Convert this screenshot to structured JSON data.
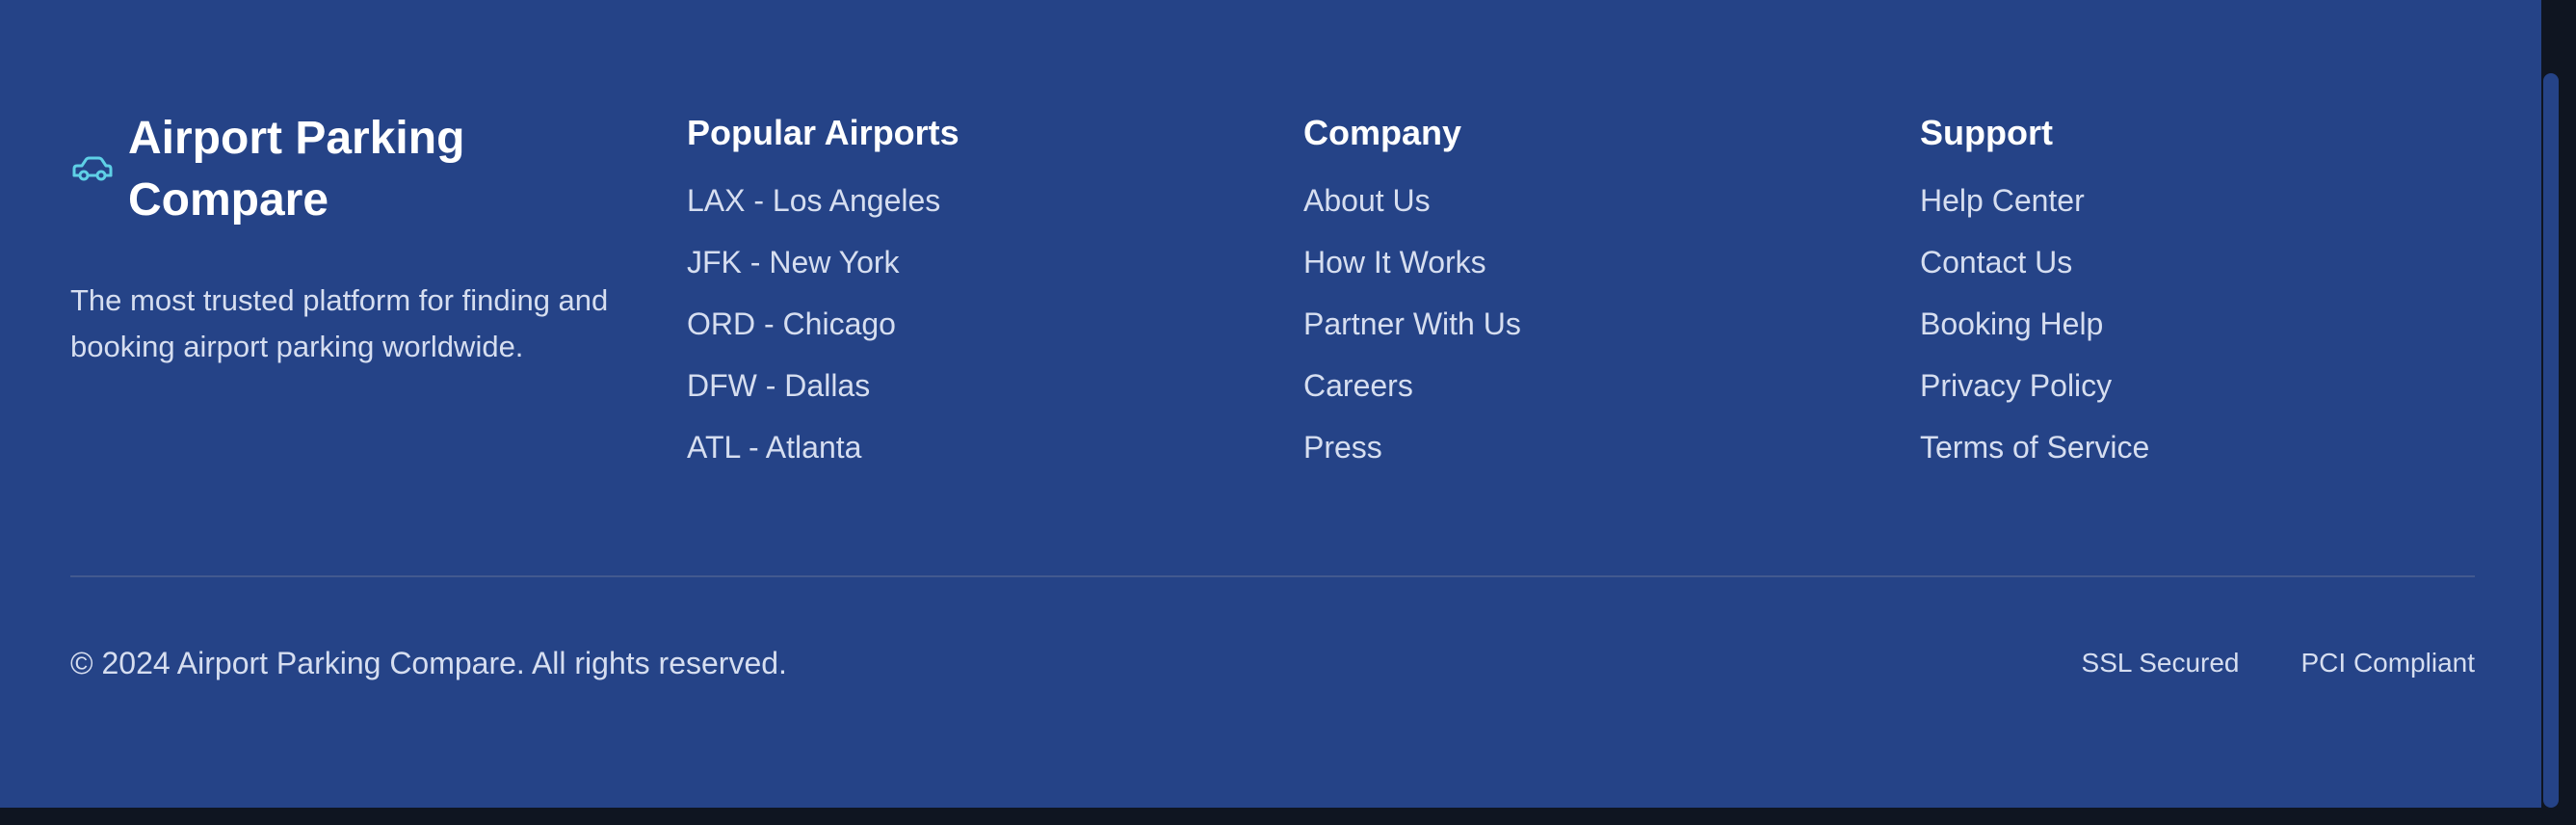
{
  "brand": {
    "title": "Airport Parking Compare",
    "icon": "car-icon",
    "description": "The most trusted platform for finding and booking airport parking worldwide."
  },
  "columns": [
    {
      "heading": "Popular Airports",
      "links": [
        "LAX - Los Angeles",
        "JFK - New York",
        "ORD - Chicago",
        "DFW - Dallas",
        "ATL - Atlanta"
      ]
    },
    {
      "heading": "Company",
      "links": [
        "About Us",
        "How It Works",
        "Partner With Us",
        "Careers",
        "Press"
      ]
    },
    {
      "heading": "Support",
      "links": [
        "Help Center",
        "Contact Us",
        "Booking Help",
        "Privacy Policy",
        "Terms of Service"
      ]
    }
  ],
  "footer": {
    "copyright": "© 2024 Airport Parking Compare. All rights reserved.",
    "badges": [
      "SSL Secured",
      "PCI Compliant"
    ]
  },
  "colors": {
    "background": "#254387",
    "accent": "#5fd0e6",
    "text": "#d6def0",
    "heading": "#ffffff"
  }
}
